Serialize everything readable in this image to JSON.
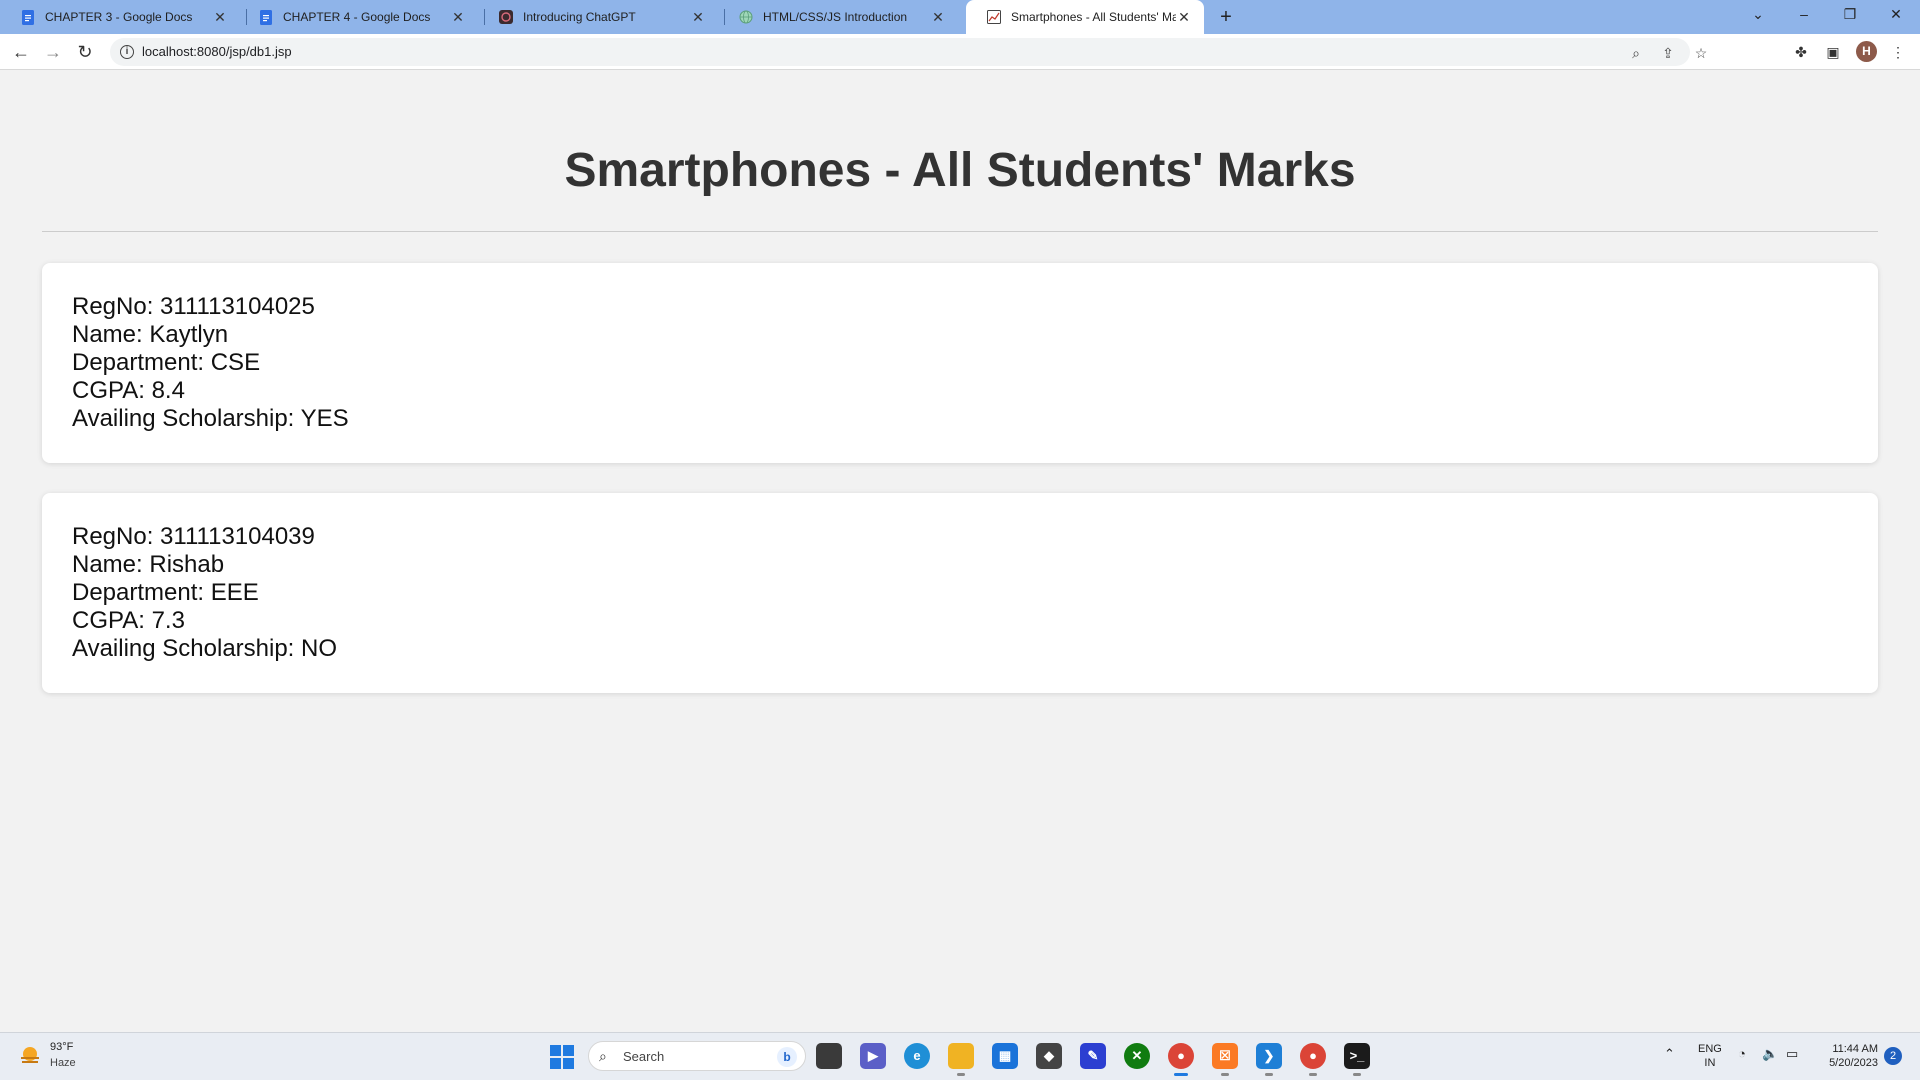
{
  "browser": {
    "tabs": [
      {
        "title": "CHAPTER 3 - Google Docs",
        "icon": "google-docs-icon"
      },
      {
        "title": "CHAPTER 4 - Google Docs",
        "icon": "google-docs-icon"
      },
      {
        "title": "Introducing ChatGPT",
        "icon": "chatgpt-icon"
      },
      {
        "title": "HTML/CSS/JS Introduction",
        "icon": "globe-icon"
      },
      {
        "title": "Smartphones - All Students' Marks",
        "icon": "page-icon"
      }
    ],
    "address": "localhost:8080/jsp/db1.jsp",
    "profile_initial": "H"
  },
  "page": {
    "title": "Smartphones - All Students' Marks",
    "students": [
      {
        "regno": "RegNo: 311113104025",
        "name": "Name: Kaytlyn",
        "department": "Department: CSE",
        "cgpa": "CGPA: 8.4",
        "scholarship": "Availing Scholarship: YES"
      },
      {
        "regno": "RegNo: 311113104039",
        "name": "Name: Rishab",
        "department": "Department: EEE",
        "cgpa": "CGPA: 7.3",
        "scholarship": "Availing Scholarship: NO"
      }
    ]
  },
  "taskbar": {
    "weather_temp": "93°F",
    "weather_desc": "Haze",
    "search_placeholder": "Search",
    "lang_top": "ENG",
    "lang_bottom": "IN",
    "time": "11:44 AM",
    "date": "5/20/2023",
    "notification_count": "2"
  },
  "colors": {
    "tabstrip": "#8fb4e9",
    "page_background": "#f2f2f2",
    "title_text": "#333333",
    "card_background": "#ffffff"
  }
}
